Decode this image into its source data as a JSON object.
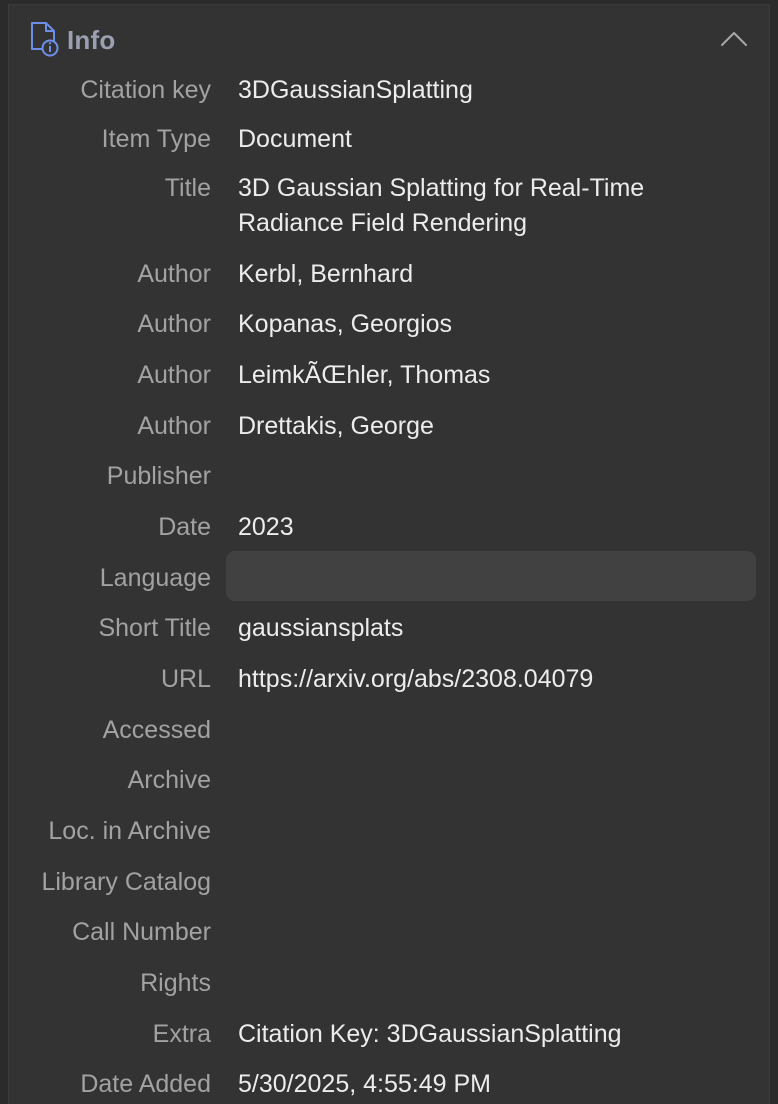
{
  "section": {
    "title": "Info",
    "icon": "document-info-icon",
    "collapse_icon": "chevron-up-icon"
  },
  "fields": [
    {
      "label": "Citation key",
      "value": "3DGaussianSplatting"
    },
    {
      "label": "Item Type",
      "value": "Document"
    },
    {
      "label": "Title",
      "value": "3D Gaussian Splatting for Real-Time Radiance Field Rendering"
    },
    {
      "label": "Author",
      "value": "Kerbl, Bernhard"
    },
    {
      "label": "Author",
      "value": "Kopanas, Georgios"
    },
    {
      "label": "Author",
      "value": "LeimkÃŒhler, Thomas"
    },
    {
      "label": "Author",
      "value": "Drettakis, George"
    },
    {
      "label": "Publisher",
      "value": ""
    },
    {
      "label": "Date",
      "value": "2023"
    },
    {
      "label": "Language",
      "value": ""
    },
    {
      "label": "Short Title",
      "value": "gaussiansplats"
    },
    {
      "label": "URL",
      "value": "https://arxiv.org/abs/2308.04079"
    },
    {
      "label": "Accessed",
      "value": ""
    },
    {
      "label": "Archive",
      "value": ""
    },
    {
      "label": "Loc. in Archive",
      "value": ""
    },
    {
      "label": "Library Catalog",
      "value": ""
    },
    {
      "label": "Call Number",
      "value": ""
    },
    {
      "label": "Rights",
      "value": ""
    },
    {
      "label": "Extra",
      "value": "Citation Key: 3DGaussianSplatting"
    },
    {
      "label": "Date Added",
      "value": "5/30/2025, 4:55:49 PM"
    }
  ],
  "colors": {
    "background": "#333333",
    "label": "#a2a2a2",
    "value": "#ececec",
    "icon_accent": "#6d8fe8",
    "focused_field": "#414141"
  }
}
